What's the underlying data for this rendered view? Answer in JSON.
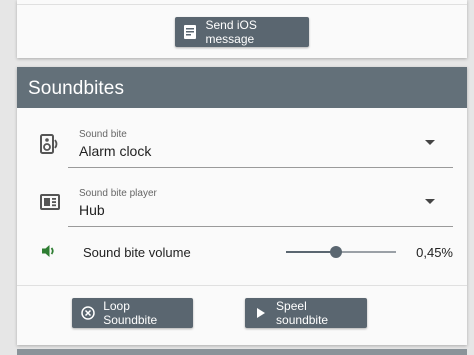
{
  "top_card": {
    "send_ios_label": "Send iOS message"
  },
  "soundbites": {
    "title": "Soundbites",
    "sound_bite": {
      "label": "Sound bite",
      "value": "Alarm clock"
    },
    "player": {
      "label": "Sound bite player",
      "value": "Hub"
    },
    "volume": {
      "label": "Sound bite volume",
      "value_text": "0,45%",
      "level": 0.45
    },
    "loop_label": "Loop Soundbite",
    "play_label": "Speel soundbite"
  },
  "colors": {
    "header_bg": "#637079",
    "button_bg": "#5a6670",
    "volume_icon": "#2e7d32"
  }
}
